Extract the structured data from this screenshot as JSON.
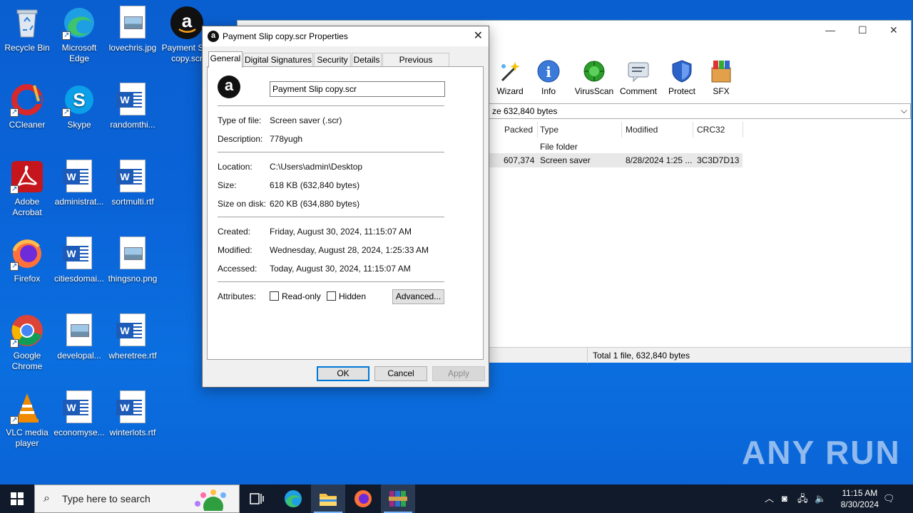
{
  "desktop": {
    "icons": [
      {
        "label": "Recycle Bin"
      },
      {
        "label": "Microsoft Edge"
      },
      {
        "label": "lovechris.jpg"
      },
      {
        "label": "Payment Slip copy.scr"
      },
      {
        "label": "CCleaner"
      },
      {
        "label": "Skype"
      },
      {
        "label": "randomthi..."
      },
      {
        "label": "Adobe Acrobat"
      },
      {
        "label": "administrat..."
      },
      {
        "label": "sortmulti.rtf"
      },
      {
        "label": "Firefox"
      },
      {
        "label": "citiesdomai..."
      },
      {
        "label": "thingsno.png"
      },
      {
        "label": "Google Chrome"
      },
      {
        "label": "developal..."
      },
      {
        "label": "wheretree.rtf"
      },
      {
        "label": "VLC media player"
      },
      {
        "label": "economyse..."
      },
      {
        "label": "winterlots.rtf"
      }
    ]
  },
  "rar": {
    "tools": [
      {
        "label": "Wizard",
        "icon": "wizard-icon"
      },
      {
        "label": "Info",
        "icon": "info-icon"
      },
      {
        "label": "VirusScan",
        "icon": "virusscan-icon"
      },
      {
        "label": "Comment",
        "icon": "comment-icon"
      },
      {
        "label": "Protect",
        "icon": "protect-icon"
      },
      {
        "label": "SFX",
        "icon": "sfx-icon"
      }
    ],
    "path_text": "ze 632,840 bytes",
    "columns": [
      "Packed",
      "Type",
      "Modified",
      "CRC32"
    ],
    "rows": [
      {
        "packed": "",
        "type": "File folder",
        "modified": "",
        "crc": ""
      },
      {
        "packed": "607,374",
        "type": "Screen saver",
        "modified": "8/28/2024 1:25 ...",
        "crc": "3C3D7D13"
      }
    ],
    "status": "Total 1 file, 632,840 bytes"
  },
  "dialog": {
    "title": "Payment Slip copy.scr Properties",
    "tabs": [
      "General",
      "Digital Signatures",
      "Security",
      "Details",
      "Previous Versions"
    ],
    "filename": "Payment Slip copy.scr",
    "labels": {
      "type": "Type of file:",
      "description": "Description:",
      "location": "Location:",
      "size": "Size:",
      "size_on_disk": "Size on disk:",
      "created": "Created:",
      "modified": "Modified:",
      "accessed": "Accessed:",
      "attributes": "Attributes:"
    },
    "values": {
      "type": "Screen saver (.scr)",
      "description": "778yugh",
      "location": "C:\\Users\\admin\\Desktop",
      "size": "618 KB (632,840 bytes)",
      "size_on_disk": "620 KB (634,880 bytes)",
      "created": "Friday, August 30, 2024, 11:15:07 AM",
      "modified": "Wednesday, August 28, 2024, 1:25:33 AM",
      "accessed": "Today, August 30, 2024, 11:15:07 AM"
    },
    "readonly": "Read-only",
    "hidden": "Hidden",
    "advanced": "Advanced...",
    "ok": "OK",
    "cancel": "Cancel",
    "apply": "Apply"
  },
  "taskbar": {
    "search_placeholder": "Type here to search",
    "time": "11:15 AM",
    "date": "8/30/2024"
  },
  "watermark": "ANY RUN"
}
